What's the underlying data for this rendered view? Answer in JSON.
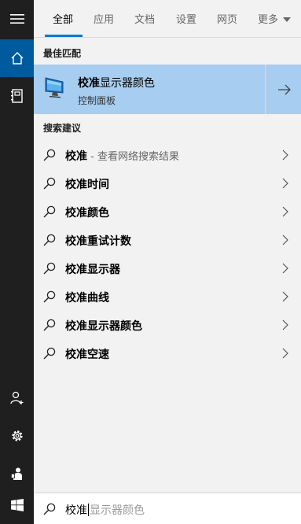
{
  "tabs": [
    {
      "label": "全部",
      "active": true
    },
    {
      "label": "应用"
    },
    {
      "label": "文档"
    },
    {
      "label": "设置"
    },
    {
      "label": "网页"
    },
    {
      "label": "更多"
    }
  ],
  "rail_icons": [
    "hamburger-icon",
    "home-icon",
    "notebook-icon",
    "user-add-icon",
    "gear-icon",
    "feedback-icon",
    "windows-logo-icon"
  ],
  "best_match": {
    "heading": "最佳匹配",
    "title_bold": "校准",
    "title_rest": "显示器颜色",
    "subtitle": "控制面板"
  },
  "suggestions_heading": "搜索建议",
  "suggestions": [
    {
      "text": "校准",
      "hint": " - 查看网络搜索结果"
    },
    {
      "text": "校准时间",
      "hint": ""
    },
    {
      "text": "校准颜色",
      "hint": ""
    },
    {
      "text": "校准重试计数",
      "hint": ""
    },
    {
      "text": "校准显示器",
      "hint": ""
    },
    {
      "text": "校准曲线",
      "hint": ""
    },
    {
      "text": "校准显示器颜色",
      "hint": ""
    },
    {
      "text": "校准空速",
      "hint": ""
    }
  ],
  "search": {
    "typed": "校准",
    "ghost": "显示器颜色"
  },
  "colors": {
    "accent": "#0078d7",
    "rail_active": "#005a9e",
    "best_bg": "#a7cdf0"
  }
}
